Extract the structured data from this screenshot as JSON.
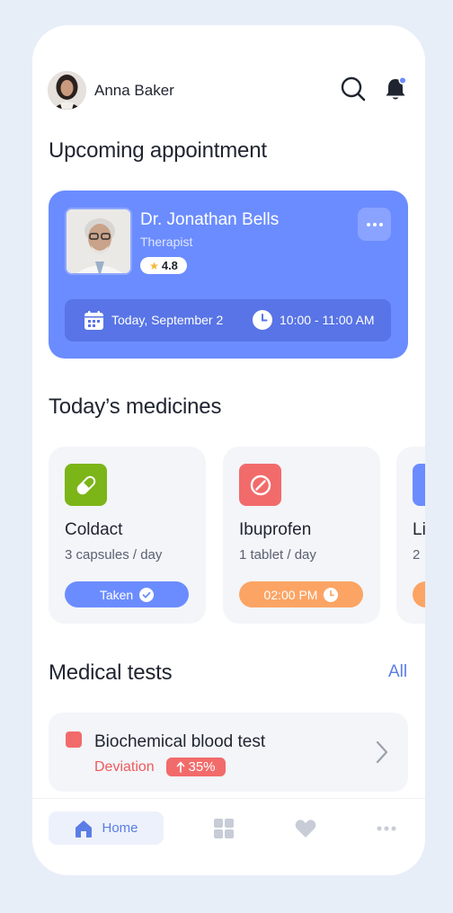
{
  "header": {
    "user_name": "Anna Baker"
  },
  "sections": {
    "appointment_title": "Upcoming appointment",
    "medicines_title": "Today’s medicines",
    "tests_title": "Medical tests",
    "tests_all_link": "All"
  },
  "appointment": {
    "doctor_name": "Dr. Jonathan Bells",
    "role": "Therapist",
    "rating": "4.8",
    "date": "Today, September 2",
    "time": "10:00 - 11:00 AM"
  },
  "medicines": [
    {
      "name": "Coldact",
      "dose": "3 capsules / day",
      "status": "Taken",
      "color": "#7cb518",
      "pill_color": "#6b8cff"
    },
    {
      "name": "Ibuprofen",
      "dose": "1 tablet / day",
      "status": "02:00 PM",
      "color": "#f26b6b",
      "pill_color": "#fca464"
    },
    {
      "name": "Li",
      "dose": "2",
      "status": "",
      "color": "#6b8cff",
      "pill_color": "#fca464"
    }
  ],
  "tests": [
    {
      "name": "Biochemical blood test",
      "status": "Deviation",
      "change": "35%",
      "color": "#f26b6b"
    }
  ],
  "nav": {
    "home_label": "Home"
  },
  "colors": {
    "accent": "#6b8cff",
    "accent_dark": "#5874e6",
    "danger": "#f26b6b",
    "orange": "#fca464",
    "green": "#7cb518"
  }
}
